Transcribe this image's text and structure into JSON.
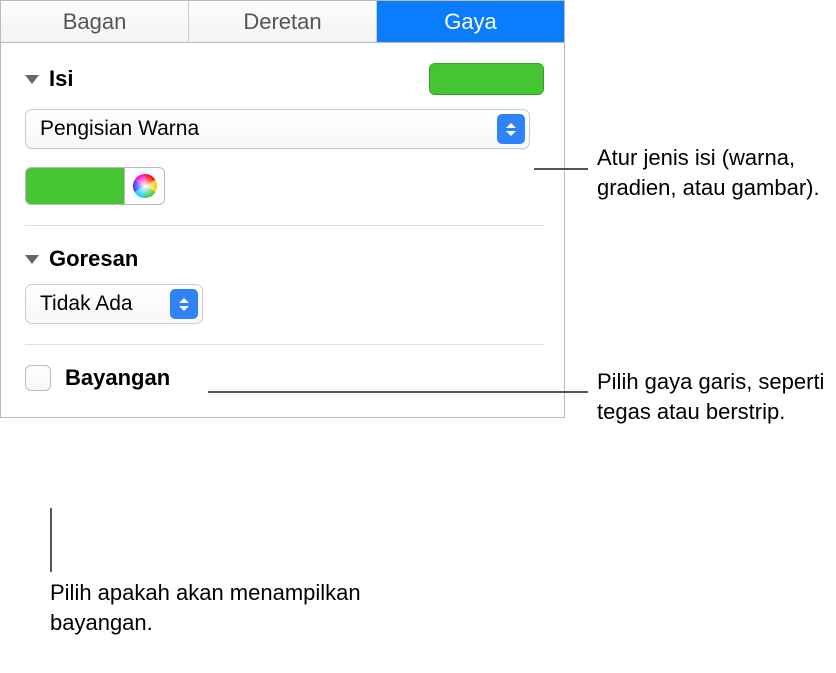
{
  "tabs": {
    "chart": "Bagan",
    "series": "Deretan",
    "style": "Gaya"
  },
  "fill": {
    "title": "Isi",
    "popup_value": "Pengisian Warna",
    "swatch_color": "#45c532"
  },
  "stroke": {
    "title": "Goresan",
    "popup_value": "Tidak Ada"
  },
  "shadow": {
    "label": "Bayangan"
  },
  "callouts": {
    "fill_type": "Atur jenis isi (warna, gradien, atau gambar).",
    "stroke_style": "Pilih gaya garis, seperti tegas atau berstrip.",
    "shadow_toggle": "Pilih apakah akan menampilkan bayangan."
  }
}
